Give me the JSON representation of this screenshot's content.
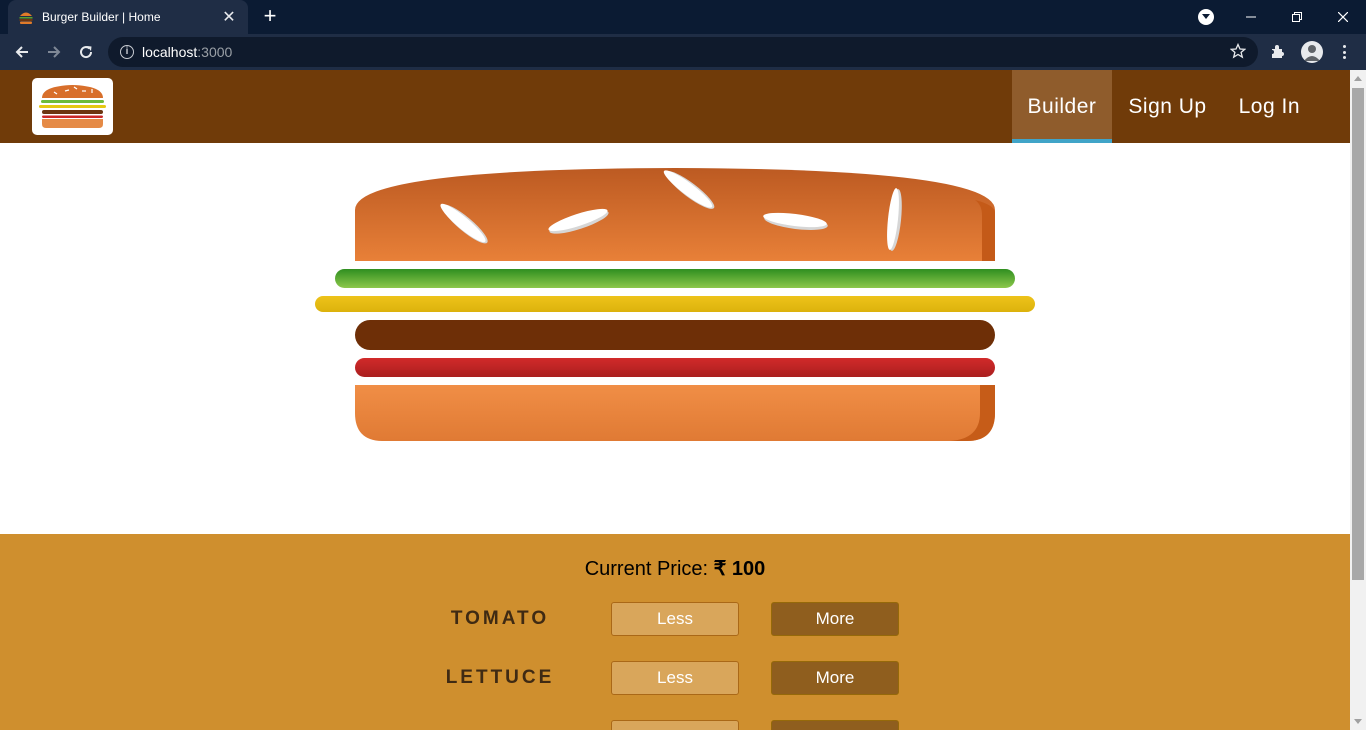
{
  "browser": {
    "tab_title": "Burger Builder | Home",
    "url_host": "localhost",
    "url_port": ":3000"
  },
  "header": {
    "nav": [
      {
        "label": "Builder",
        "active": true
      },
      {
        "label": "Sign Up",
        "active": false
      },
      {
        "label": "Log In",
        "active": false
      }
    ]
  },
  "controls": {
    "price_label": "Current Price:",
    "price_value": "₹ 100",
    "rows": [
      {
        "label": "TOMATO",
        "less": "Less",
        "more": "More"
      },
      {
        "label": "LETTUCE",
        "less": "Less",
        "more": "More"
      }
    ]
  },
  "colors": {
    "header_bg": "#703b09",
    "nav_active_bg": "#8f5c2c",
    "nav_active_border": "#40a4c8",
    "controls_bg": "#cf8f2e",
    "less_bg": "#d9a65b",
    "more_bg": "#8f5e1e"
  }
}
